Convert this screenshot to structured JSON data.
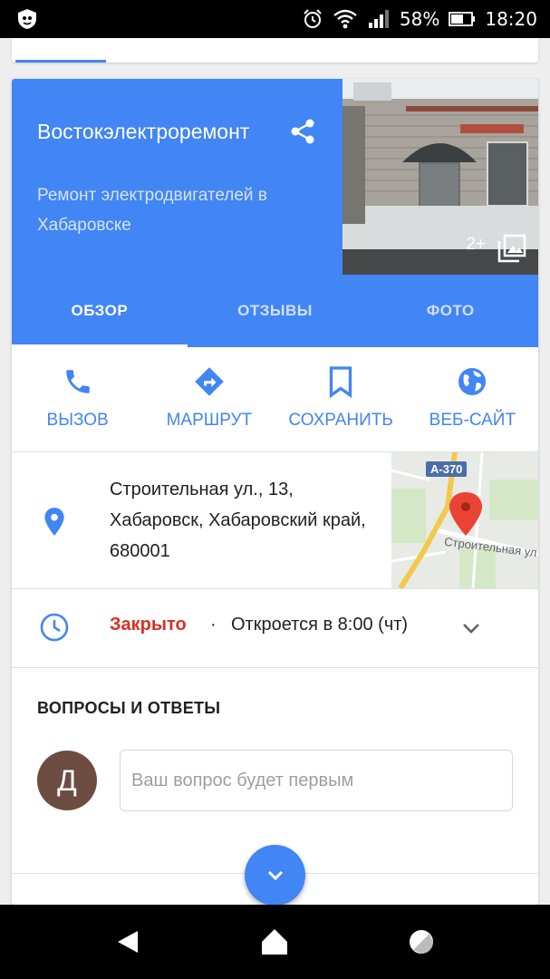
{
  "status_bar": {
    "battery_percent": "58%",
    "time": "18:20",
    "icons": [
      "app-icon",
      "alarm-icon",
      "wifi-icon",
      "signal-icon",
      "battery-icon"
    ]
  },
  "place": {
    "name": "Востокэлектроремонт",
    "category": "Ремонт электродвигателей в Хабаровске",
    "photo_count": "2+"
  },
  "tabs": [
    {
      "label": "ОБЗОР",
      "active": true
    },
    {
      "label": "ОТЗЫВЫ",
      "active": false
    },
    {
      "label": "ФОТО",
      "active": false
    }
  ],
  "actions": [
    {
      "label": "ВЫЗОВ",
      "icon": "phone-icon"
    },
    {
      "label": "МАРШРУТ",
      "icon": "directions-icon"
    },
    {
      "label": "СОХРАНИТЬ",
      "icon": "bookmark-icon"
    },
    {
      "label": "ВЕБ-САЙТ",
      "icon": "globe-icon"
    }
  ],
  "address": {
    "text": "Строительная ул., 13, Хабаровск, Хабаровский край, 680001",
    "map_route": "A-370",
    "map_street": "Строительная ул"
  },
  "hours": {
    "status": "Закрыто",
    "separator": "·",
    "next": "Откроется в 8:00 (чт)"
  },
  "qa": {
    "title": "ВОПРОСЫ И ОТВЕТЫ",
    "avatar_letter": "Д",
    "placeholder": "Ваш вопрос будет первым"
  },
  "colors": {
    "accent": "#4285f4",
    "closed": "#d93025",
    "avatar": "#6d4c41"
  }
}
